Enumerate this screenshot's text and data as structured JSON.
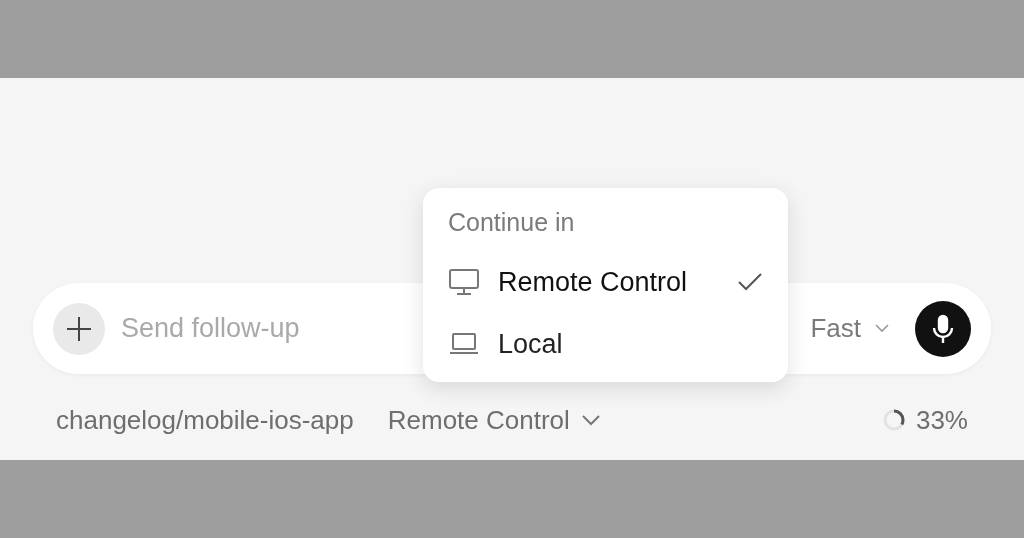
{
  "composer": {
    "placeholder": "Send follow-up",
    "model": "Fast"
  },
  "menu": {
    "title": "Continue in",
    "items": [
      {
        "label": "Remote Control",
        "kind": "monitor",
        "selected": true
      },
      {
        "label": "Local",
        "kind": "laptop",
        "selected": false
      }
    ]
  },
  "footer": {
    "branch": "changelog/mobile-ios-app",
    "mode": "Remote Control",
    "context": {
      "level": 0.33,
      "reading": "33%"
    }
  }
}
